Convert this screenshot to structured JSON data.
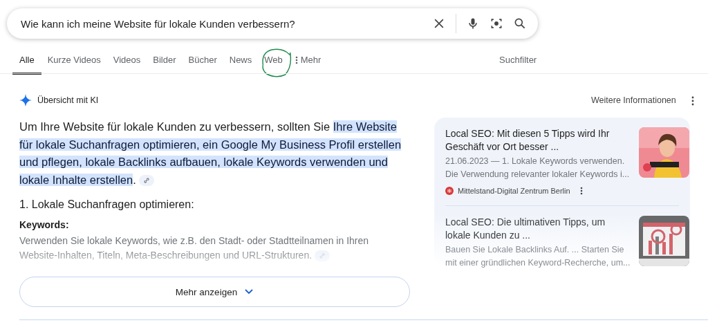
{
  "search": {
    "value": "Wie kann ich meine Website für lokale Kunden verbessern?"
  },
  "tabs": [
    {
      "label": "Alle",
      "selected": true
    },
    {
      "label": "Kurze Videos",
      "selected": false
    },
    {
      "label": "Videos",
      "selected": false
    },
    {
      "label": "Bilder",
      "selected": false
    },
    {
      "label": "Bücher",
      "selected": false
    },
    {
      "label": "News",
      "selected": false
    },
    {
      "label": "Web",
      "selected": false,
      "circled": true
    },
    {
      "label": "Mehr",
      "selected": false,
      "kind": "more"
    }
  ],
  "filter": "Suchfilter",
  "overview": {
    "title": "Übersicht mit KI",
    "more_info": "Weitere Informationen",
    "intro": "Um Ihre Website für lokale Kunden zu verbessern, sollten Sie ",
    "highlight": "Ihre Website für lokale Suchanfragen optimieren, ein Google My Business Profil erstellen und pflegen, lokale Backlinks aufbauen, lokale Keywords verwenden und lokale Inhalte erstellen",
    "end": ".",
    "heading": "1. Lokale Suchanfragen optimieren:",
    "subheading": "Keywords:",
    "body": "Verwenden Sie lokale Keywords, wie z.B. den Stadt- oder Stadtteilnamen in Ihren Website-Inhalten, Titeln, Meta-Beschreibungen und URL-Strukturen.",
    "show_more": "Mehr anzeigen"
  },
  "sources": [
    {
      "title": "Local SEO: Mit diesen 5 Tipps wird Ihr Geschäft vor Ort besser ...",
      "snippet": "21.06.2023 — 1. Lokale Keywords verwenden. Die Verwendung relevanter lokaler Keywords i...",
      "site": "Mittelstand-Digital Zentrum Berlin",
      "faded": false
    },
    {
      "title": "Local SEO: Die ultimativen Tipps, um lokale Kunden zu ...",
      "snippet": "Bauen Sie Lokale Backlinks Auf. ... Starten Sie mit einer gründlichen Keyword-Recherche, um...",
      "faded": true
    }
  ]
}
